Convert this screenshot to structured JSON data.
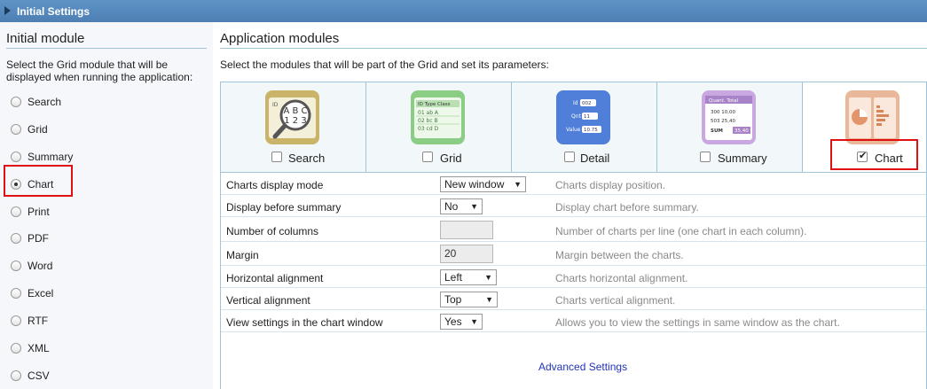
{
  "titlebar": {
    "title": "Initial Settings"
  },
  "left": {
    "heading": "Initial module",
    "description": "Select the Grid module that will be displayed when running the application:",
    "options": [
      {
        "label": "Search",
        "checked": false
      },
      {
        "label": "Grid",
        "checked": false
      },
      {
        "label": "Summary",
        "checked": false
      },
      {
        "label": "Chart",
        "checked": true
      },
      {
        "label": "Print",
        "checked": false
      },
      {
        "label": "PDF",
        "checked": false
      },
      {
        "label": "Word",
        "checked": false
      },
      {
        "label": "Excel",
        "checked": false
      },
      {
        "label": "RTF",
        "checked": false
      },
      {
        "label": "XML",
        "checked": false
      },
      {
        "label": "CSV",
        "checked": false
      }
    ]
  },
  "right": {
    "heading": "Application modules",
    "description": "Select the modules that will be part of the Grid and set its parameters:",
    "modules": [
      {
        "label": "Search",
        "checked": false,
        "icon": "search-module-icon",
        "letters": "A B C 1 2 3",
        "id_label": "ID"
      },
      {
        "label": "Grid",
        "checked": false,
        "icon": "grid-module-icon",
        "headers": [
          "ID",
          "Type",
          "Class"
        ],
        "rows": [
          [
            "01",
            "ab",
            "A"
          ],
          [
            "02",
            "bc",
            "B"
          ],
          [
            "03",
            "cd",
            "D"
          ]
        ]
      },
      {
        "label": "Detail",
        "checked": false,
        "icon": "detail-module-icon",
        "fields": [
          [
            "Id",
            "002"
          ],
          [
            "Qnt",
            "11"
          ],
          [
            "Value",
            "10.75"
          ]
        ]
      },
      {
        "label": "Summary",
        "checked": false,
        "icon": "summary-module-icon",
        "headers": [
          "Quant.",
          "Total"
        ],
        "rows": [
          [
            "300",
            "10,00"
          ],
          [
            "503",
            "25,40"
          ],
          [
            "SUM",
            "35,40"
          ]
        ]
      },
      {
        "label": "Chart",
        "checked": true,
        "icon": "chart-module-icon"
      }
    ],
    "settings": [
      {
        "label": "Charts display mode",
        "type": "select",
        "value": "New window",
        "hint": "Charts display position."
      },
      {
        "label": "Display before summary",
        "type": "select",
        "value": "No",
        "hint": "Display chart before summary."
      },
      {
        "label": "Number of columns",
        "type": "input",
        "value": "",
        "hint": "Number of charts per line (one chart in each column)."
      },
      {
        "label": "Margin",
        "type": "input",
        "value": "20",
        "hint": "Margin between the charts."
      },
      {
        "label": "Horizontal alignment",
        "type": "select",
        "value": "Left",
        "hint": "Charts horizontal alignment."
      },
      {
        "label": "Vertical alignment",
        "type": "select",
        "value": "Top",
        "hint": "Charts vertical alignment."
      },
      {
        "label": "View settings in the chart window",
        "type": "select",
        "value": "Yes",
        "hint": "Allows you to view the settings in same window as the chart."
      }
    ],
    "advanced_link": "Advanced Settings"
  },
  "colors": {
    "titlebar": "#5589bd",
    "highlight": "#e01010",
    "link": "#2233bb",
    "border": "#9fc4dc"
  }
}
